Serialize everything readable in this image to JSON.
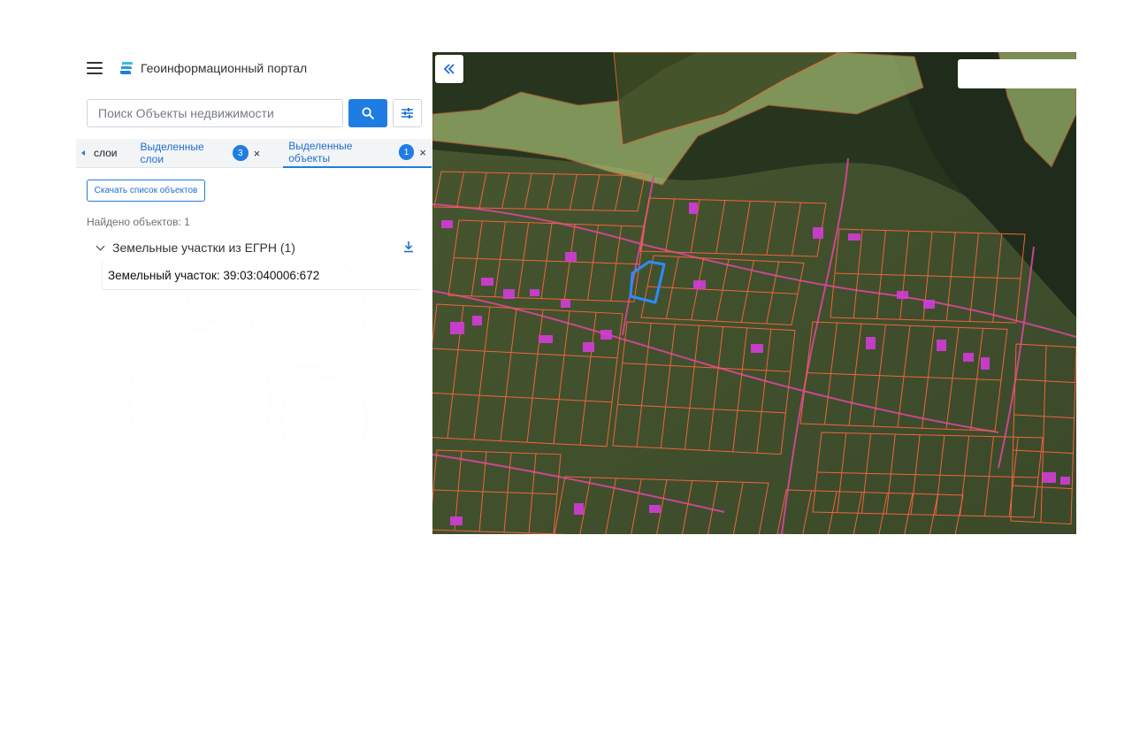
{
  "header": {
    "title": "Геоинформационный портал",
    "menu_icon": "hamburger-menu-icon",
    "logo_icon": "portal-logo-icon"
  },
  "search": {
    "placeholder": "Поиск Объекты недвижимости",
    "value": "",
    "search_icon": "search-icon",
    "filter_icon": "sliders-filter-icon"
  },
  "tabs": {
    "back_label": "слои",
    "selected_layers_label": "Выделенные слои",
    "selected_layers_count": "3",
    "selected_objects_label": "Выделенные объекты",
    "selected_objects_count": "1",
    "close_glyph": "×"
  },
  "results": {
    "download_list_label": "Скачать список объектов",
    "found_text": "Найдено объектов: 1",
    "group_label": "Земельные участки из ЕГРН (1)",
    "items": [
      {
        "label": "Земельный участок: 39:03:040006:672"
      }
    ]
  },
  "map": {
    "collapse_icon": "double-chevron-left-icon",
    "colors": {
      "forest": "#33432a",
      "field": "#4c5a34",
      "forest_zone": "#b6cf7c",
      "parcel_line": "#f0643c",
      "road_line": "#d8479c",
      "building": "#d33cd8",
      "selected_parcel": "#2a8cff"
    }
  },
  "colors": {
    "accent": "#1f7ce3",
    "link": "#1f6fcf"
  }
}
